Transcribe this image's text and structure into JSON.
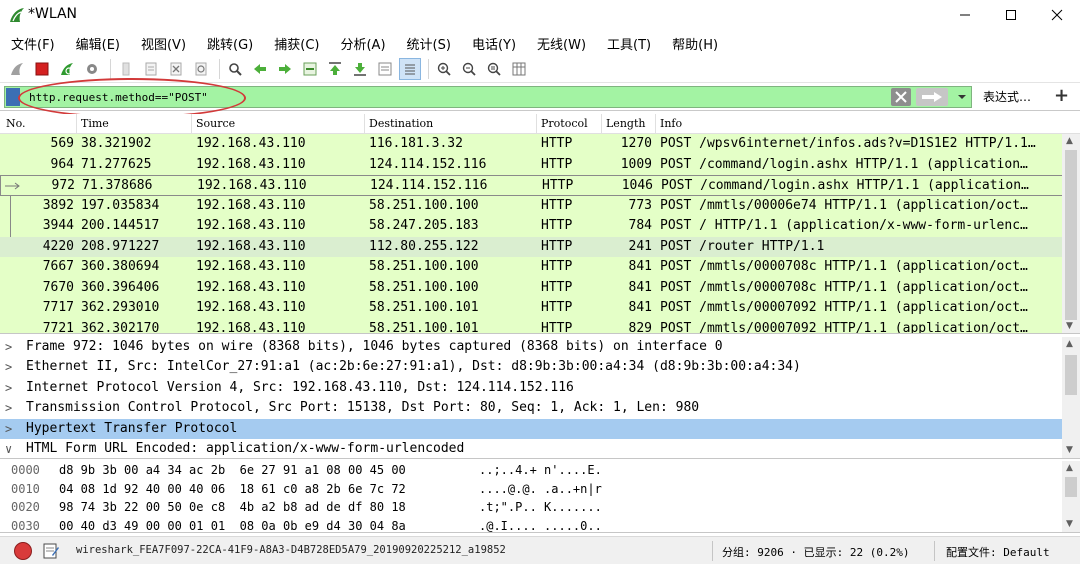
{
  "window": {
    "title": "*WLAN"
  },
  "menu": [
    "文件(F)",
    "编辑(E)",
    "视图(V)",
    "跳转(G)",
    "捕获(C)",
    "分析(A)",
    "统计(S)",
    "电话(Y)",
    "无线(W)",
    "工具(T)",
    "帮助(H)"
  ],
  "filter": {
    "value": "http.request.method==\"POST\"",
    "expression_label": "表达式…",
    "plus_label": "+"
  },
  "packet_list": {
    "headers": {
      "no": "No.",
      "time": "Time",
      "source": "Source",
      "destination": "Destination",
      "protocol": "Protocol",
      "length": "Length",
      "info": "Info"
    },
    "rows": [
      {
        "no": "569",
        "time": "38.321902",
        "source": "192.168.43.110",
        "destination": "116.181.3.32",
        "protocol": "HTTP",
        "length": "1270",
        "info": "POST /wpsv6internet/infos.ads?v=D1S1E2 HTTP/1.1…"
      },
      {
        "no": "964",
        "time": "71.277625",
        "source": "192.168.43.110",
        "destination": "124.114.152.116",
        "protocol": "HTTP",
        "length": "1009",
        "info": "POST /command/login.ashx HTTP/1.1  (application…"
      },
      {
        "no": "972",
        "time": "71.378686",
        "source": "192.168.43.110",
        "destination": "124.114.152.116",
        "protocol": "HTTP",
        "length": "1046",
        "info": "POST /command/login.ashx HTTP/1.1  (application…"
      },
      {
        "no": "3892",
        "time": "197.035834",
        "source": "192.168.43.110",
        "destination": "58.251.100.100",
        "protocol": "HTTP",
        "length": "773",
        "info": "POST /mmtls/00006e74 HTTP/1.1  (application/oct…"
      },
      {
        "no": "3944",
        "time": "200.144517",
        "source": "192.168.43.110",
        "destination": "58.247.205.183",
        "protocol": "HTTP",
        "length": "784",
        "info": "POST / HTTP/1.1  (application/x-www-form-urlenc…"
      },
      {
        "no": "4220",
        "time": "208.971227",
        "source": "192.168.43.110",
        "destination": "112.80.255.122",
        "protocol": "HTTP",
        "length": "241",
        "info": "POST /router HTTP/1.1"
      },
      {
        "no": "7667",
        "time": "360.380694",
        "source": "192.168.43.110",
        "destination": "58.251.100.100",
        "protocol": "HTTP",
        "length": "841",
        "info": "POST /mmtls/0000708c HTTP/1.1  (application/oct…"
      },
      {
        "no": "7670",
        "time": "360.396406",
        "source": "192.168.43.110",
        "destination": "58.251.100.100",
        "protocol": "HTTP",
        "length": "841",
        "info": "POST /mmtls/0000708c HTTP/1.1  (application/oct…"
      },
      {
        "no": "7717",
        "time": "362.293010",
        "source": "192.168.43.110",
        "destination": "58.251.100.101",
        "protocol": "HTTP",
        "length": "841",
        "info": "POST /mmtls/00007092 HTTP/1.1  (application/oct…"
      },
      {
        "no": "7721",
        "time": "362.302170",
        "source": "192.168.43.110",
        "destination": "58.251.100.101",
        "protocol": "HTTP",
        "length": "829",
        "info": "POST /mmtls/00007092 HTTP/1.1  (application/oct…"
      }
    ]
  },
  "details": [
    "Frame 972: 1046 bytes on wire (8368 bits), 1046 bytes captured (8368 bits) on interface 0",
    "Ethernet II, Src: IntelCor_27:91:a1 (ac:2b:6e:27:91:a1), Dst: d8:9b:3b:00:a4:34 (d8:9b:3b:00:a4:34)",
    "Internet Protocol Version 4, Src: 192.168.43.110, Dst: 124.114.152.116",
    "Transmission Control Protocol, Src Port: 15138, Dst Port: 80, Seq: 1, Ack: 1, Len: 980",
    "Hypertext Transfer Protocol",
    "HTML Form URL Encoded: application/x-www-form-urlencoded"
  ],
  "bytes": [
    {
      "offset": "0000",
      "hex": "d8 9b 3b 00 a4 34 ac 2b  6e 27 91 a1 08 00 45 00",
      "ascii": "..;..4.+ n'....E."
    },
    {
      "offset": "0010",
      "hex": "04 08 1d 92 40 00 40 06  18 61 c0 a8 2b 6e 7c 72",
      "ascii": "....@.@. .a..+n|r"
    },
    {
      "offset": "0020",
      "hex": "98 74 3b 22 00 50 0e c8  4b a2 b8 ad de df 80 18",
      "ascii": ".t;\".P.. K......."
    },
    {
      "offset": "0030",
      "hex": "00 40 d3 49 00 00 01 01  08 0a 0b e9 d4 30 04 8a",
      "ascii": ".@.I.... .....0.."
    }
  ],
  "status": {
    "file": "wireshark_FEA7F097-22CA-41F9-A8A3-D4B728ED5A79_20190920225212_a19852",
    "packets": "分组: 9206 · 已显示: 22 (0.2%)",
    "profile": "配置文件: Default"
  },
  "colors": {
    "http_row": "#e4ffc7",
    "filter_ok": "#a3f3a3",
    "selected_detail": "#a5cbf0",
    "annotation": "#d23a3a"
  }
}
